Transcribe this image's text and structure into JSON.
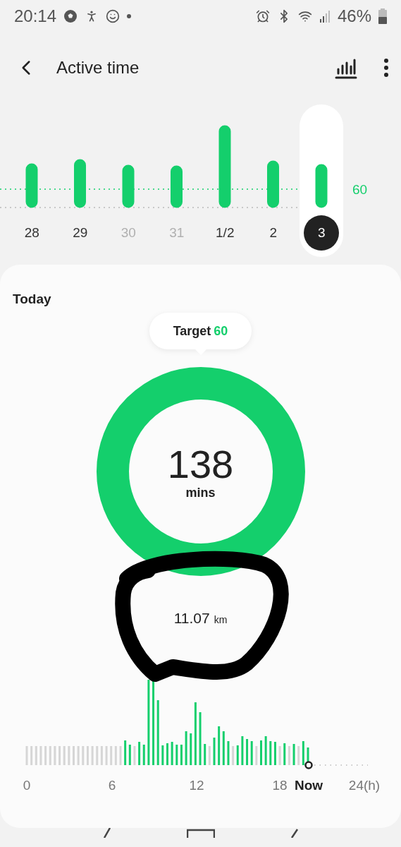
{
  "status_bar": {
    "time": "20:14",
    "battery": "46%"
  },
  "header": {
    "title": "Active time"
  },
  "week": {
    "target_label": "60",
    "days": [
      {
        "label": "28",
        "dimmed": false,
        "selected": false
      },
      {
        "label": "29",
        "dimmed": false,
        "selected": false
      },
      {
        "label": "30",
        "dimmed": true,
        "selected": false
      },
      {
        "label": "31",
        "dimmed": true,
        "selected": false
      },
      {
        "label": "1/2",
        "dimmed": false,
        "selected": false
      },
      {
        "label": "2",
        "dimmed": false,
        "selected": false
      },
      {
        "label": "3",
        "dimmed": false,
        "selected": true
      }
    ]
  },
  "today": {
    "title": "Today",
    "target": {
      "label": "Target",
      "value": "60"
    },
    "active": {
      "value": "138",
      "unit": "mins"
    },
    "distance": {
      "value": "11.07",
      "unit": "km"
    },
    "hourly_axis": [
      {
        "label": "0",
        "kind": "tick"
      },
      {
        "label": "6",
        "kind": "tick"
      },
      {
        "label": "12",
        "kind": "tick"
      },
      {
        "label": "18",
        "kind": "tick"
      },
      {
        "label": "Now",
        "kind": "now"
      },
      {
        "label": "24(h)",
        "kind": "tick"
      }
    ]
  }
}
